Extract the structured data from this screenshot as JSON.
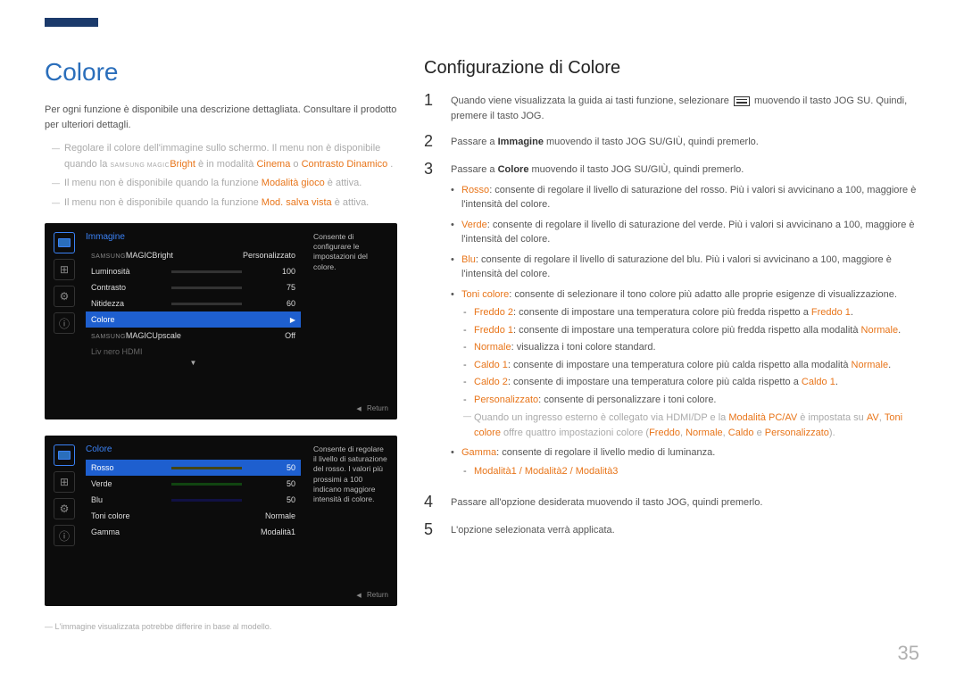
{
  "page_number": "35",
  "left": {
    "title": "Colore",
    "intro": "Per ogni funzione è disponibile una descrizione dettagliata. Consultare il prodotto per ulteriori dettagli.",
    "notes": {
      "n1_a": "Regolare il colore dell'immagine sullo schermo. Il menu non è disponibile quando la ",
      "n1_magic": "SAMSUNG MAGIC",
      "n1_b": "Bright",
      "n1_c": " è in modalità ",
      "n1_d": "Cinema",
      "n1_e": " o ",
      "n1_f": "Contrasto Dinamico",
      "n1_g": ".",
      "n2_a": "Il menu non è disponibile quando la funzione ",
      "n2_b": "Modalità gioco",
      "n2_c": " è attiva.",
      "n3_a": "Il menu non è disponibile quando la funzione ",
      "n3_b": "Mod. salva vista",
      "n3_c": " è attiva."
    },
    "osd1": {
      "title": "Immagine",
      "desc": "Consente di configurare le impostazioni del colore.",
      "rows": {
        "r1_label": "MAGICBright",
        "r1_label_prefix": "SAMSUNG",
        "r1_val": "Personalizzato",
        "r2_label": "Luminosità",
        "r2_val": "100",
        "r3_label": "Contrasto",
        "r3_val": "75",
        "r4_label": "Nitidezza",
        "r4_val": "60",
        "r5_label": "Colore",
        "r6_label": "MAGICUpscale",
        "r6_label_prefix": "SAMSUNG",
        "r6_val": "Off",
        "r7_label": "Liv nero HDMI"
      },
      "return": "Return"
    },
    "osd2": {
      "title": "Colore",
      "desc": "Consente di regolare il livello di saturazione del rosso. I valori più prossimi a 100 indicano maggiore intensità di colore.",
      "rows": {
        "r1_label": "Rosso",
        "r1_val": "50",
        "r2_label": "Verde",
        "r2_val": "50",
        "r3_label": "Blu",
        "r3_val": "50",
        "r4_label": "Toni colore",
        "r4_val": "Normale",
        "r5_label": "Gamma",
        "r5_val": "Modalità1"
      },
      "return": "Return"
    },
    "footnote": "L'immagine visualizzata potrebbe differire in base al modello."
  },
  "right": {
    "title": "Configurazione di Colore",
    "step1_a": "Quando viene visualizzata la guida ai tasti funzione, selezionare ",
    "step1_b": " muovendo il tasto JOG SU. Quindi, premere il tasto JOG.",
    "step2_a": "Passare a ",
    "step2_b": "Immagine",
    "step2_c": " muovendo il tasto JOG SU/GIÙ, quindi premerlo.",
    "step3_a": "Passare a ",
    "step3_b": "Colore",
    "step3_c": " muovendo il tasto JOG SU/GIÙ, quindi premerlo.",
    "b_rosso_a": "Rosso",
    "b_rosso_b": ": consente di regolare il livello di saturazione del rosso. Più i valori si avvicinano a 100, maggiore è l'intensità del colore.",
    "b_verde_a": "Verde",
    "b_verde_b": ": consente di regolare il livello di saturazione del verde. Più i valori si avvicinano a 100, maggiore è l'intensità del colore.",
    "b_blu_a": "Blu",
    "b_blu_b": ": consente di regolare il livello di saturazione del blu. Più i valori si avvicinano a 100, maggiore è l'intensità del colore.",
    "b_toni_a": "Toni colore",
    "b_toni_b": ": consente di selezionare il tono colore più adatto alle proprie esigenze di visualizzazione.",
    "t_f2_a": "Freddo 2",
    "t_f2_b": ": consente di impostare una temperatura colore più fredda rispetto a ",
    "t_f2_c": "Freddo 1",
    "t_f2_d": ".",
    "t_f1_a": "Freddo 1",
    "t_f1_b": ": consente di impostare una temperatura colore più fredda rispetto alla modalità ",
    "t_f1_c": "Normale",
    "t_f1_d": ".",
    "t_n_a": "Normale",
    "t_n_b": ": visualizza i toni colore standard.",
    "t_c1_a": "Caldo 1",
    "t_c1_b": ": consente di impostare una temperatura colore più calda rispetto alla modalità ",
    "t_c1_c": "Normale",
    "t_c1_d": ".",
    "t_c2_a": "Caldo 2",
    "t_c2_b": ": consente di impostare una temperatura colore più calda rispetto a ",
    "t_c2_c": "Caldo 1",
    "t_c2_d": ".",
    "t_p_a": "Personalizzato",
    "t_p_b": ": consente di personalizzare i toni colore.",
    "t_note_a": "Quando un ingresso esterno è collegato via HDMI/DP e la ",
    "t_note_b": "Modalità PC/AV",
    "t_note_c": " è impostata su ",
    "t_note_d": "AV",
    "t_note_e": ", ",
    "t_note_f": "Toni colore",
    "t_note_g": " offre quattro impostazioni colore (",
    "t_note_h": "Freddo",
    "t_note_i": ", ",
    "t_note_j": "Normale",
    "t_note_k": ", ",
    "t_note_l": "Caldo",
    "t_note_m": " e ",
    "t_note_n": "Personalizzato",
    "t_note_o": ").",
    "b_gamma_a": "Gamma",
    "b_gamma_b": ": consente di regolare il livello medio di luminanza.",
    "g_modes": "Modalità1 / Modalità2 / Modalità3",
    "step4": "Passare all'opzione desiderata muovendo il tasto JOG, quindi premerlo.",
    "step5": "L'opzione selezionata verrà applicata."
  }
}
